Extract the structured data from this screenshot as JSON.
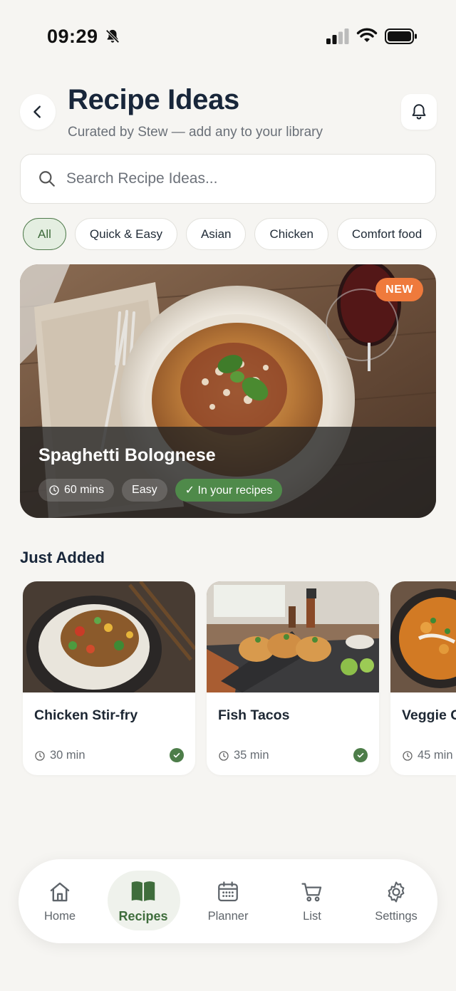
{
  "status_bar": {
    "time": "09:29"
  },
  "header": {
    "title": "Recipe Ideas",
    "subtitle": "Curated by Stew — add any to your library"
  },
  "search": {
    "placeholder": "Search Recipe Ideas..."
  },
  "filters": [
    "All",
    "Quick & Easy",
    "Asian",
    "Chicken",
    "Comfort food"
  ],
  "featured": {
    "badge": "NEW",
    "title": "Spaghetti Bolognese",
    "time": "60 mins",
    "difficulty": "Easy",
    "status": "✓ In your recipes"
  },
  "section_title": "Just Added",
  "cards": [
    {
      "name": "Chicken Stir-fry",
      "time": "30 min",
      "saved": true
    },
    {
      "name": "Fish Tacos",
      "time": "35 min",
      "saved": true
    },
    {
      "name": "Veggie Chickpea Curry",
      "time": "45 min",
      "saved": false
    }
  ],
  "nav": [
    {
      "label": "Home",
      "icon": "home-icon"
    },
    {
      "label": "Recipes",
      "icon": "book-icon",
      "active": true
    },
    {
      "label": "Planner",
      "icon": "calendar-icon"
    },
    {
      "label": "List",
      "icon": "cart-icon"
    },
    {
      "label": "Settings",
      "icon": "gear-icon"
    }
  ],
  "colors": {
    "accent": "#4f7a4b",
    "badge": "#ef7a3c",
    "background": "#f6f5f2"
  }
}
